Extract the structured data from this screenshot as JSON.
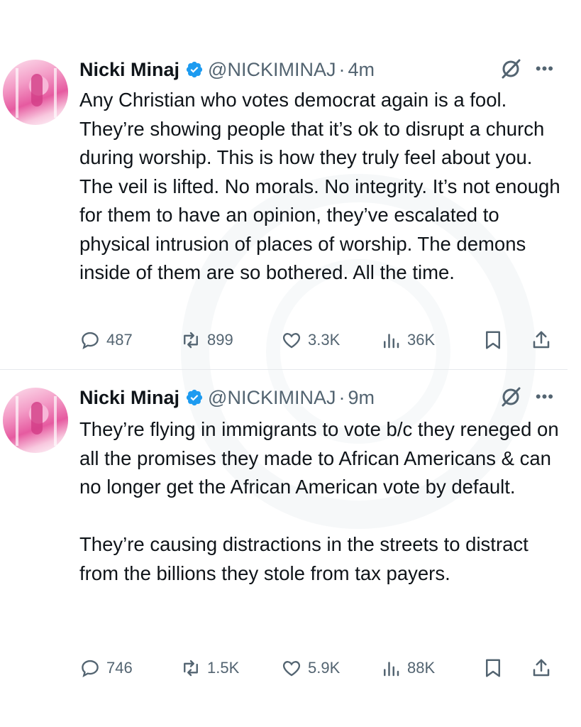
{
  "tweets": [
    {
      "author": "Nicki Minaj",
      "handle": "@NICKIMINAJ",
      "separator": "·",
      "time": "4m",
      "text": "Any Christian who votes democrat again is a fool. They’re showing people that it’s ok to disrupt a church during worship. This is how they truly feel about you. The veil is lifted. No morals. No integrity. It’s not enough for them to have an opinion, they’ve escalated to physical intrusion of places of worship. The demons inside of them are so bothered. All the time.",
      "replies": "487",
      "reposts": "899",
      "likes": "3.3K",
      "views": "36K"
    },
    {
      "author": "Nicki Minaj",
      "handle": "@NICKIMINAJ",
      "separator": "·",
      "time": "9m",
      "text": "They’re flying in immigrants to vote b/c they reneged on all the promises they made to African Americans & can no longer get the African American vote by default.\n\nThey’re causing distractions in the streets to distract from the billions they stole from tax payers.",
      "replies": "746",
      "reposts": "1.5K",
      "likes": "5.9K",
      "views": "88K"
    }
  ],
  "colors": {
    "verified": "#1d9bf0",
    "muted": "#536471",
    "text": "#0f1419"
  },
  "icons": [
    "verified-badge-icon",
    "grok-icon",
    "more-icon",
    "reply-icon",
    "repost-icon",
    "like-icon",
    "views-icon",
    "bookmark-icon",
    "share-icon"
  ]
}
